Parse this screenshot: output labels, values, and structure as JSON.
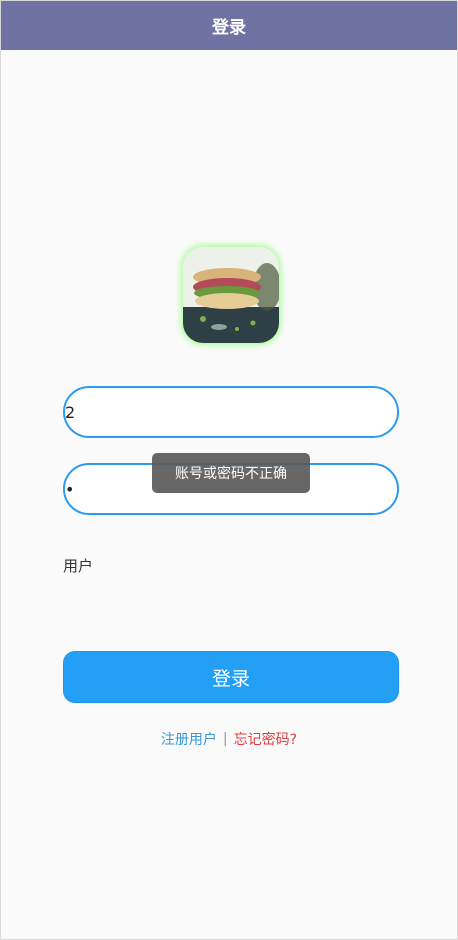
{
  "header": {
    "title": "登录"
  },
  "form": {
    "username_value": "2",
    "password_value": "•"
  },
  "toast": {
    "message": "账号或密码不正确"
  },
  "role": {
    "label": "用户"
  },
  "actions": {
    "login_label": "登录",
    "register_label": "注册用户",
    "separator": "|",
    "forgot_label": "忘记密码?"
  },
  "colors": {
    "header_bg": "#6f73a3",
    "accent": "#23a0f6",
    "link_blue": "#3a98d9",
    "link_red": "#e23c3c"
  }
}
